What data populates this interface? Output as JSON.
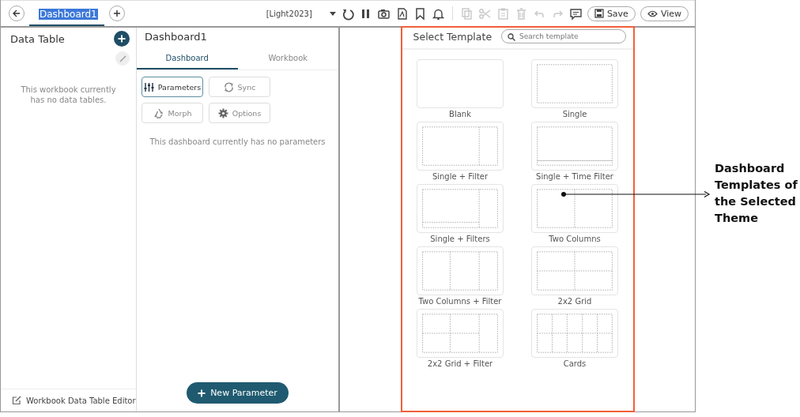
{
  "top_bar": {
    "tab": "Dashboard1",
    "theme": "[Light2023]",
    "tools": [
      {
        "kind": "reload",
        "disabled": false
      },
      {
        "kind": "pause",
        "disabled": false
      },
      {
        "kind": "camera",
        "disabled": false
      },
      {
        "kind": "pdf",
        "disabled": false
      },
      {
        "kind": "bookmark",
        "disabled": false
      },
      {
        "kind": "bell",
        "disabled": false
      },
      {
        "kind": "copy",
        "disabled": true
      },
      {
        "kind": "cut",
        "disabled": true
      },
      {
        "kind": "paste",
        "disabled": true
      },
      {
        "kind": "delete",
        "disabled": true
      },
      {
        "kind": "undo",
        "disabled": true
      },
      {
        "kind": "redo",
        "disabled": true
      },
      {
        "kind": "comment",
        "disabled": false
      }
    ],
    "save": "Save",
    "view": "View"
  },
  "data_panel": {
    "title": "Data Table",
    "empty_text": "This workbook currently has no data tables.",
    "footer": "Workbook Data Table Editor"
  },
  "dashboard_panel": {
    "title": "Dashboard1",
    "tabs": [
      {
        "label": "Dashboard",
        "selected": true
      },
      {
        "label": "Workbook",
        "selected": false
      }
    ],
    "buttons": [
      {
        "kind": "parameters",
        "label": "Parameters",
        "selected": true
      },
      {
        "kind": "sync",
        "label": "Sync",
        "selected": false
      },
      {
        "kind": "morph",
        "label": "Morph",
        "selected": false
      },
      {
        "kind": "options",
        "label": "Options",
        "selected": false
      }
    ],
    "empty_text": "This dashboard currently has no parameters",
    "new_button": "New Parameter"
  },
  "template_panel": {
    "title": "Select Template",
    "search": {
      "placeholder": "Search template"
    },
    "templates": [
      {
        "kind": "blank",
        "label": "Blank"
      },
      {
        "kind": "single",
        "label": "Single"
      },
      {
        "kind": "single-filter",
        "label": "Single + Filter"
      },
      {
        "kind": "single-time-filter",
        "label": "Single + Time Filter"
      },
      {
        "kind": "single-filters",
        "label": "Single + Filters"
      },
      {
        "kind": "two-columns",
        "label": "Two Columns"
      },
      {
        "kind": "two-columns-filter",
        "label": "Two Columns + Filter"
      },
      {
        "kind": "grid",
        "label": "2x2 Grid"
      },
      {
        "kind": "grid-filter",
        "label": "2x2 Grid + Filter"
      },
      {
        "kind": "cards",
        "label": "Cards"
      }
    ]
  },
  "callout": "Dashboard Templates of the Selected Theme"
}
